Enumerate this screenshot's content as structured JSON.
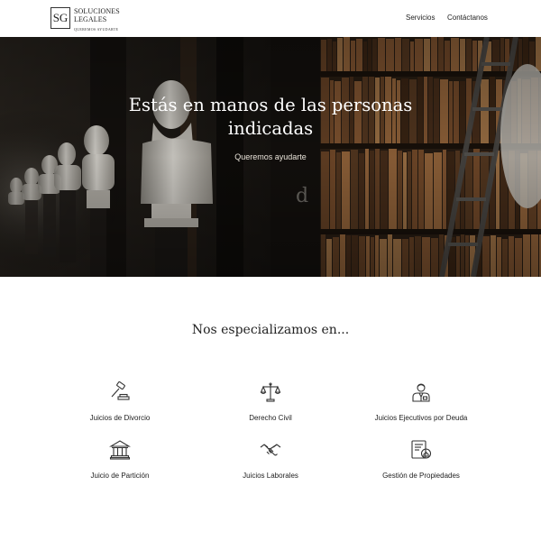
{
  "header": {
    "logo": {
      "mark": "SG",
      "line1": "SOLUCIONES",
      "line2": "LEGALES",
      "tagline": "QUEREMOS AYUDARTE"
    },
    "nav": [
      {
        "label": "Servicios"
      },
      {
        "label": "Contáctanos"
      }
    ]
  },
  "hero": {
    "title_line1": "Estás en manos de las personas",
    "title_line2": "indicadas",
    "subtitle": "Queremos ayudarte"
  },
  "specialties": {
    "title": "Nos especializamos en...",
    "items": [
      {
        "label": "Juicios de Divorcio",
        "icon": "gavel-icon"
      },
      {
        "label": "Derecho Civil",
        "icon": "scales-icon"
      },
      {
        "label": "Juicios Ejecutivos por Deuda",
        "icon": "executive-icon"
      },
      {
        "label": "Juicio de Partición",
        "icon": "courthouse-icon"
      },
      {
        "label": "Juicios Laborales",
        "icon": "handshake-icon"
      },
      {
        "label": "Gestión de Propiedades",
        "icon": "property-document-icon"
      }
    ]
  },
  "colors": {
    "icon_stroke": "#333333",
    "hero_bg": "#1a1612",
    "book_accent": "#8a5a34"
  }
}
